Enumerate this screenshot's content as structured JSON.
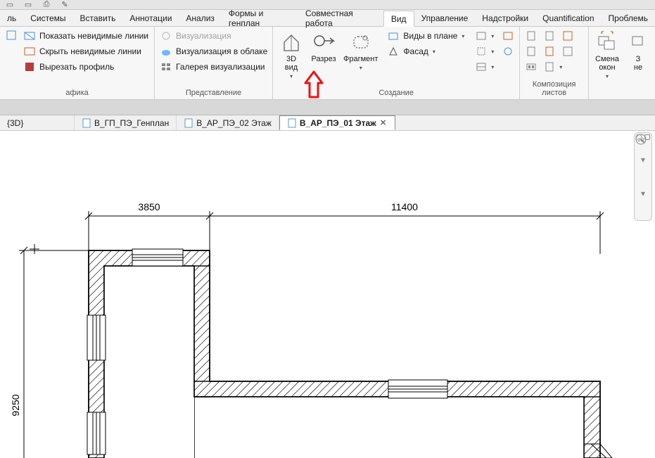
{
  "menu": {
    "items": [
      "ль",
      "Системы",
      "Вставить",
      "Аннотации",
      "Анализ",
      "Формы и генплан",
      "Совместная работа",
      "Вид",
      "Управление",
      "Надстройки",
      "Quantification",
      "Проблемь"
    ],
    "active_index": 7
  },
  "ribbon": {
    "panels": {
      "graphics": {
        "title": "афика",
        "show_hidden": "Показать невидимые линии",
        "hide_hidden": "Скрыть невидимые линии",
        "cut_profile": "Вырезать профиль"
      },
      "presentation": {
        "title": "Представление",
        "vis_disabled": "Визуализация",
        "vis_cloud": "Визуализация  в облаке",
        "vis_gallery": "Галерея  визуализации"
      },
      "creation": {
        "title": "Создание",
        "view3d": "3D\nвид",
        "section": "Разрез",
        "fragment": "Фрагмент",
        "plan_views": "Виды в плане",
        "elevation": "Фасад"
      },
      "sheets": {
        "title": "Композиция листов"
      },
      "windows": {
        "title": "",
        "swap": "Смена\nокон",
        "close_hidden": "З\nне"
      }
    }
  },
  "doctabs": {
    "tabs": [
      {
        "label": "{3D}"
      },
      {
        "label": "В_ГП_ПЭ_Генплан"
      },
      {
        "label": "В_АР_ПЭ_02 Этаж"
      },
      {
        "label": "В_АР_ПЭ_01 Этаж"
      }
    ],
    "active_index": 3
  },
  "drawing": {
    "dim_top_left": "3850",
    "dim_top_right": "11400",
    "dim_left": "9250"
  }
}
